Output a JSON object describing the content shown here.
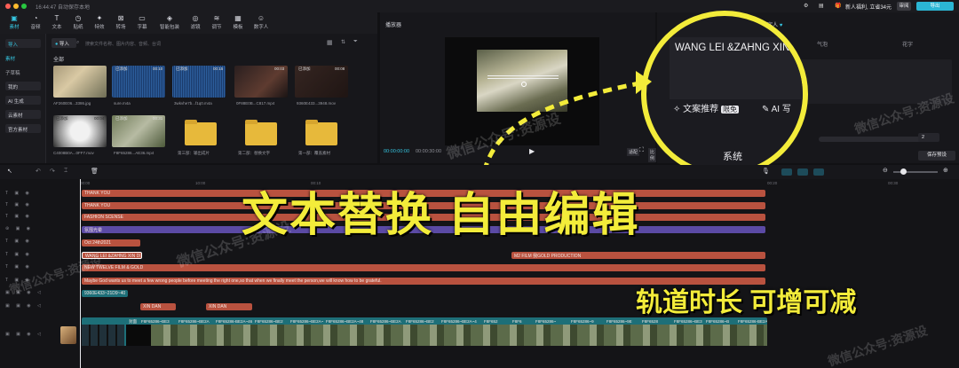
{
  "titlebar": {
    "time_label": "16:44:47 自动保存本地",
    "promo": "新人福利, 立省34元",
    "review_button": "审阅",
    "export_button": "导出"
  },
  "toolbar": {
    "items": [
      {
        "label": "素材",
        "icon": "media-icon"
      },
      {
        "label": "音频",
        "icon": "audio-icon"
      },
      {
        "label": "文本",
        "icon": "text-icon"
      },
      {
        "label": "贴纸",
        "icon": "sticker-icon"
      },
      {
        "label": "特效",
        "icon": "effects-icon"
      },
      {
        "label": "转场",
        "icon": "transition-icon"
      },
      {
        "label": "字幕",
        "icon": "caption-icon"
      },
      {
        "label": "智能包装",
        "icon": "smart-pack-icon"
      },
      {
        "label": "滤镜",
        "icon": "filter-icon"
      },
      {
        "label": "调节",
        "icon": "adjust-icon"
      },
      {
        "label": "模板",
        "icon": "template-icon"
      },
      {
        "label": "数字人",
        "icon": "avatar-icon"
      }
    ]
  },
  "media": {
    "nav": {
      "import": "导入",
      "material": "素材",
      "subtitle": "子草稿",
      "mine": "我的",
      "ai": "AI 生成",
      "cloud": "云素材",
      "official": "官方素材"
    },
    "import_button": "导入",
    "search_placeholder": "搜索文件名称、图片内容、音频、台词",
    "all_label": "全部",
    "items": [
      {
        "name": "AF260E06...3386.jpg",
        "added": "",
        "duration": ""
      },
      {
        "name": "sure.m4a",
        "added": "已添加",
        "duration": "00:10"
      },
      {
        "name": "3wkvhe7b...f1q0.m4a",
        "added": "已添加",
        "duration": "00:15"
      },
      {
        "name": "0F88E0B...C817.mp4",
        "added": "",
        "duration": "00:03"
      },
      {
        "name": "9360E433...3948.mov",
        "added": "已添加",
        "duration": "00:08"
      },
      {
        "name": "C4008B0A...0FF7.mov",
        "added": "已添加",
        "duration": "00:04"
      },
      {
        "name": "F8F65286...AE36.mp4",
        "added": "已添加",
        "duration": "00:31"
      },
      {
        "name": "第三部：输出成片",
        "added": "",
        "duration": ""
      },
      {
        "name": "第二部：替换文字",
        "added": "",
        "duration": ""
      },
      {
        "name": "第一部：覆盖素材",
        "added": "",
        "duration": ""
      }
    ]
  },
  "player": {
    "title": "播放器",
    "time_current": "00:00:00:00",
    "time_total": "00:00:30:00",
    "button_a": "适配",
    "button_b": "比例"
  },
  "right_panel": {
    "tab": "数字人",
    "text_value": "WANG LEI &ZAHNG XIN D",
    "col_a": "气泡",
    "col_b": "花字",
    "recommend": "文案推荐",
    "limited": "限免",
    "ai_write": "AI 写",
    "system": "系统",
    "number": "2",
    "save_preset": "保存预设"
  },
  "ruler": {
    "t0": "00:00",
    "t1": "10:00",
    "t2": "00:10",
    "t3": "10:00",
    "t4": "00:20",
    "t5": "00:30"
  },
  "tracks": {
    "row1": "THANK YOU",
    "row2": "THANK YOU",
    "row3": "FASHION SCENSE",
    "row4": "氛围光晕",
    "row5": "Oct 24th2021",
    "row6a": "WANG LEI &ZAHNG XIN DI",
    "row6b": "M2 FILM 我GOLD PRODUCTION",
    "row7": "NEW TWELVE FILM & GOLD",
    "row8": "Maybe God wants us to meet a few wrong people before meeting the right one,so that when we finally meet the person,we will know how to be grateful.",
    "row9": "9360E433~21D9~40",
    "row10a": "XIN DAN",
    "row10b": "XIN DAN",
    "video_cover": "封面",
    "video_clip": "F8F65286~BE3",
    "video_clip_a": "F8F65286~BE2A",
    "video_clip_b": "F8F65286-BE2A~46",
    "video_clip_c": "F8F6",
    "video_clip_d": "F8F65286~BE2",
    "video_clip_e": "F8F65286~BE2A~4",
    "video_clip_f": "F8F65286~BE2A~48",
    "video_clip_g": "F8F652",
    "video_clip_h": "F8F65286~",
    "video_clip_i": "F8F65286~9",
    "video_clip_j": "F8F65286~9E",
    "video_clip_k": "F8F6528",
    "video_clip_l": "F8F65286~BE3",
    "video_clip_m": "F8F65286~B",
    "video_clip_n": "F8F65286-BE2A-46"
  },
  "overlay": {
    "headline": "文本替换 自由编辑",
    "subline": "轨道时长 可增可减",
    "watermark": "微信公众号:资源设"
  },
  "colors": {
    "accent": "#36c5e0",
    "highlight_yellow": "#f3ec3a",
    "text_clip": "#b9523f",
    "effect_clip": "#5b4aa5"
  }
}
